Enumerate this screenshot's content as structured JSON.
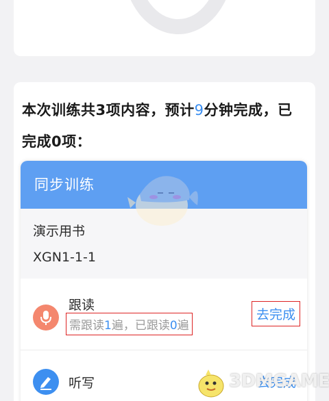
{
  "summary": {
    "p1": "本次训练共3项内容，预计",
    "minutes": "9",
    "p2": "分钟完成，已完成0项："
  },
  "sync": {
    "title": "同步训练",
    "book_name": "演示用书",
    "book_code": "XGN1-1-1"
  },
  "tasks": [
    {
      "title": "跟读",
      "sub_a": "需跟读",
      "sub_n1": "1",
      "sub_b": "遍，已跟读",
      "sub_n2": "0",
      "sub_c": "遍",
      "action": "去完成",
      "icon": "microphone-icon"
    },
    {
      "title": "听写",
      "action": "去完成",
      "icon": "pen-icon"
    }
  ],
  "watermark": {
    "text": "3DMGAME"
  },
  "colors": {
    "accent": "#3c8ff0",
    "header": "#5e9ff2",
    "mic": "#f4876e",
    "highlight_box": "#dd2222"
  }
}
